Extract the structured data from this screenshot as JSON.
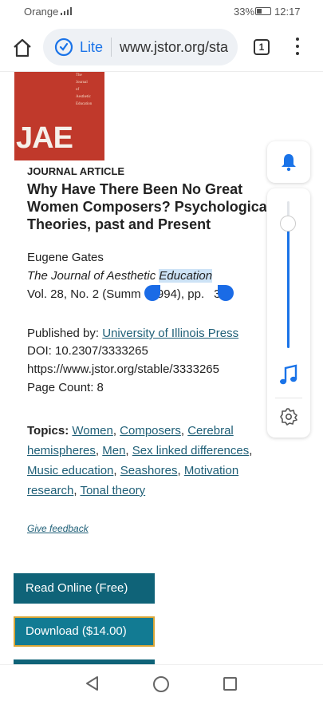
{
  "status_bar": {
    "carrier": "Orange",
    "battery": "33%",
    "time": "12:17",
    "icons": [
      "signal-icon",
      "battery-icon"
    ]
  },
  "browser": {
    "mode_label": "Lite",
    "url": "www.jstor.org/stable/3333265",
    "tab_count": "1",
    "icons": [
      "home-icon",
      "lite-speed-icon",
      "menu-dots-icon"
    ]
  },
  "cover": {
    "small_lines": [
      "The",
      "Journal",
      "of",
      "Aesthetic",
      "Education"
    ],
    "letters": "JAE"
  },
  "article": {
    "content_type": "JOURNAL ARTICLE",
    "title_lines": [
      "Why Have There Been No Great",
      "Women Composers? Psychological",
      "Theories, past and Present"
    ],
    "author": "Eugene Gates",
    "journal_pre": "The Journal of Aesthetic ",
    "journal_selected": "Education",
    "volume_part1": "Vol. 28, No. 2 (Summ",
    "volume_part2": "1994), pp.",
    "volume_part3": "34",
    "published_by_label": "Published by: ",
    "publisher": "University of Illinois Press",
    "doi": "DOI: 10.2307/3333265",
    "stable_url": "https://www.jstor.org/stable/3333265",
    "page_count": "Page Count: 8"
  },
  "topics": {
    "label": "Topics:",
    "items": [
      "Women",
      "Composers",
      "Cerebral hemispheres",
      "Men",
      "Sex linked differences",
      "Music education",
      "Seashores",
      "Motivation research",
      "Tonal theory"
    ]
  },
  "feedback_label": "Give feedback",
  "buttons": {
    "read_online": "Read Online (Free)",
    "download": "Download ($14.00)"
  },
  "widget": {
    "volume_level_fraction": 0.85,
    "icons": [
      "bell-icon",
      "music-note-icon",
      "gear-icon"
    ]
  },
  "nav_bar": {
    "icons": [
      "back-icon",
      "home-circle-icon",
      "recent-apps-icon"
    ]
  },
  "colors": {
    "accent_blue": "#1a73e8",
    "link_teal": "#1f5f77",
    "button_teal": "#0f6378",
    "cover_red": "#c0392b",
    "download_border": "#d7a536"
  }
}
